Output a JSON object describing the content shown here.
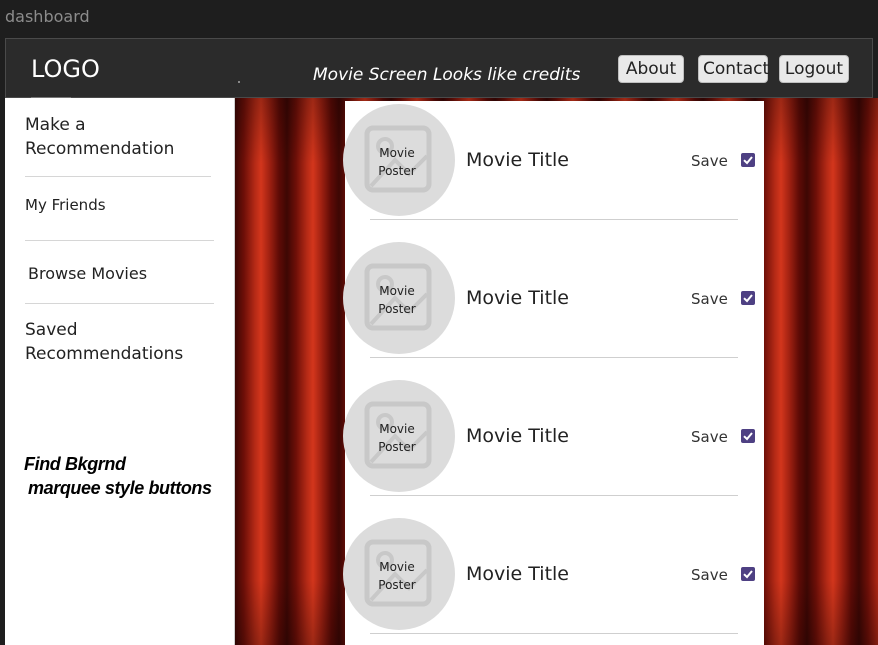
{
  "frame": {
    "title": "dashboard"
  },
  "header": {
    "logo": "LOGO",
    "tagline": "Movie Screen Looks like credits",
    "nav": {
      "about": "About",
      "contact": "Contact",
      "logout": "Logout"
    }
  },
  "sidebar": {
    "items": [
      {
        "label": "Make a\nRecommendation"
      },
      {
        "label": "My Friends"
      },
      {
        "label": "Browse Movies"
      },
      {
        "label": "Saved\nRecommendations"
      }
    ],
    "note_line1": "Find Bkgrnd",
    "note_line2": "marquee style buttons"
  },
  "movies": [
    {
      "poster_line1": "Movie",
      "poster_line2": "Poster",
      "title": "Movie Title",
      "save_label": "Save",
      "saved": true
    },
    {
      "poster_line1": "Movie",
      "poster_line2": "Poster",
      "title": "Movie Title",
      "save_label": "Save",
      "saved": true
    },
    {
      "poster_line1": "Movie",
      "poster_line2": "Poster",
      "title": "Movie Title",
      "save_label": "Save",
      "saved": true
    },
    {
      "poster_line1": "Movie",
      "poster_line2": "Poster",
      "title": "Movie Title",
      "save_label": "Save",
      "saved": true
    }
  ],
  "icons": {
    "poster_placeholder": "image-placeholder-icon",
    "checkbox": "checkmark-icon"
  },
  "colors": {
    "checkbox": "#4e4083",
    "curtain": "#b52a16",
    "header": "#2b2b2b"
  }
}
